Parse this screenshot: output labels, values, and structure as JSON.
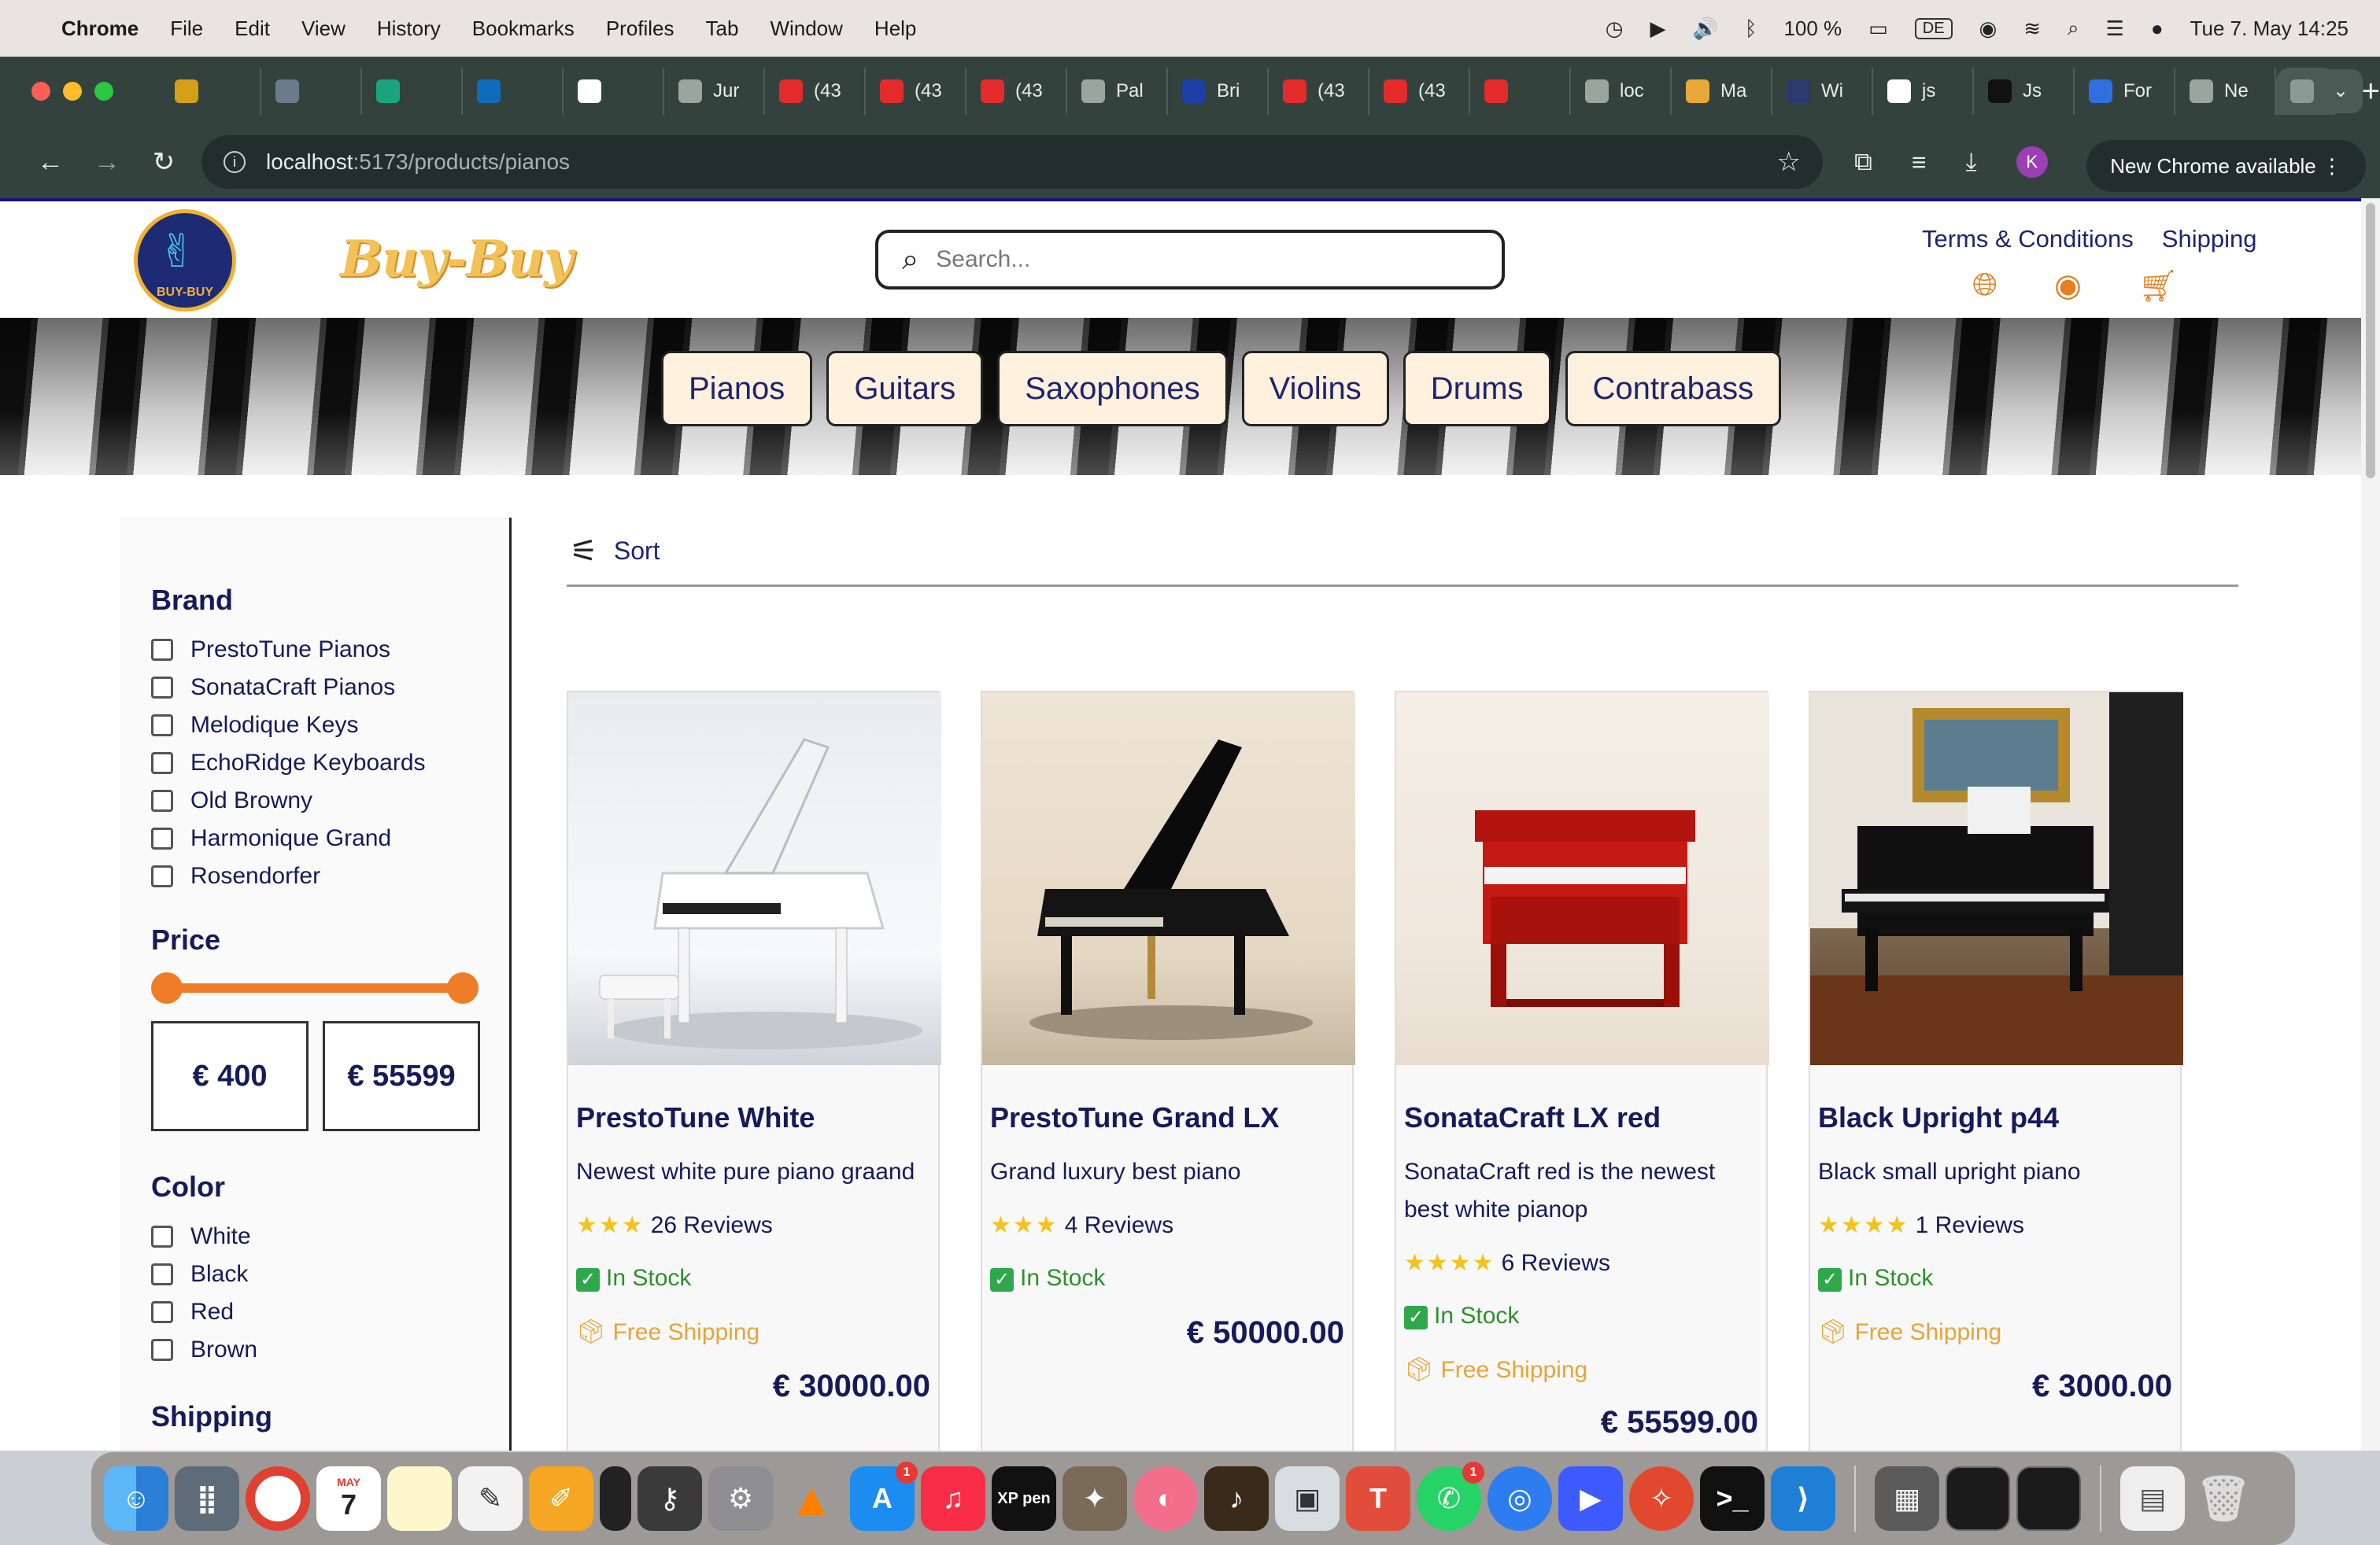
{
  "menubar": {
    "app": "Chrome",
    "items": [
      "File",
      "Edit",
      "View",
      "History",
      "Bookmarks",
      "Profiles",
      "Tab",
      "Window",
      "Help"
    ],
    "battery": "100 %",
    "input_source": "DE",
    "clock": "Tue 7. May  14:25"
  },
  "browser": {
    "tabs": [
      {
        "label": "",
        "color": "#d4a017"
      },
      {
        "label": "",
        "color": "#6b7b8c"
      },
      {
        "label": "",
        "color": "#19a37e"
      },
      {
        "label": "",
        "color": "#0f6cbd"
      },
      {
        "label": "",
        "color": "#ffffff"
      },
      {
        "label": "Jur",
        "color": "#9aa5a0"
      },
      {
        "label": "(43",
        "color": "#e32b2b"
      },
      {
        "label": "(43",
        "color": "#e32b2b"
      },
      {
        "label": "(43",
        "color": "#e32b2b"
      },
      {
        "label": "Pal",
        "color": "#9aa5a0"
      },
      {
        "label": "Bri",
        "color": "#1d3fa6"
      },
      {
        "label": "(43",
        "color": "#e32b2b"
      },
      {
        "label": "(43",
        "color": "#e32b2b"
      },
      {
        "label": "",
        "color": "#e32b2b"
      },
      {
        "label": "loc",
        "color": "#9aa5a0"
      },
      {
        "label": "Ma",
        "color": "#e8a93a"
      },
      {
        "label": "Wi",
        "color": "#2b3a6e"
      },
      {
        "label": "js",
        "color": "#ffffff"
      },
      {
        "label": "Js",
        "color": "#111111"
      },
      {
        "label": "For",
        "color": "#2f6fe0"
      },
      {
        "label": "Ne",
        "color": "#9aa5a0"
      }
    ],
    "active_tab_close": "✕",
    "new_tab": "+",
    "url_host": "localhost",
    "url_path": ":5173/products/pianos",
    "profile_initial": "K",
    "update_pill": "New Chrome available"
  },
  "site": {
    "logo_ring_text": "BUY-BUY",
    "wordmark": "Buy-Buy",
    "search_placeholder": "Search...",
    "links": [
      "Terms & Conditions",
      "Shipping"
    ],
    "categories": [
      "Pianos",
      "Guitars",
      "Saxophones",
      "Violins",
      "Drums",
      "Contrabass"
    ]
  },
  "filters": {
    "brand_heading": "Brand",
    "brands": [
      "PrestoTune Pianos",
      "SonataCraft Pianos",
      "Melodique Keys",
      "EchoRidge Keyboards",
      "Old Browny",
      "Harmonique Grand",
      "Rosendorfer"
    ],
    "price_heading": "Price",
    "price_min": "€ 400",
    "price_max": "€ 55599",
    "color_heading": "Color",
    "colors": [
      "White",
      "Black",
      "Red",
      "Brown"
    ],
    "shipping_heading": "Shipping"
  },
  "sort_label": "Sort",
  "products": [
    {
      "title": "PrestoTune White",
      "desc": "Newest white pure piano graand",
      "stars": "★★★",
      "reviews": "26 Reviews",
      "stock": "In Stock",
      "shipping": "Free Shipping",
      "price": "€ 30000.00"
    },
    {
      "title": "PrestoTune Grand LX",
      "desc": "Grand luxury best piano",
      "stars": "★★★",
      "reviews": "4 Reviews",
      "stock": "In Stock",
      "shipping": "",
      "price": "€ 50000.00"
    },
    {
      "title": "SonataCraft LX red",
      "desc": "SonataCraft red is the newest best white pianop",
      "stars": "★★★★",
      "reviews": "6 Reviews",
      "stock": "In Stock",
      "shipping": "Free Shipping",
      "price": "€ 55599.00"
    },
    {
      "title": "Black Upright p44",
      "desc": "Black small upright piano",
      "stars": "★★★★",
      "reviews": "1 Reviews",
      "stock": "In Stock",
      "shipping": "Free Shipping",
      "price": "€ 3000.00"
    }
  ],
  "dock": {
    "calendar_month": "MAY",
    "calendar_day": "7",
    "badge_appstore": "1",
    "badge_whatsapp": "1",
    "xp_label": "XP pen"
  }
}
